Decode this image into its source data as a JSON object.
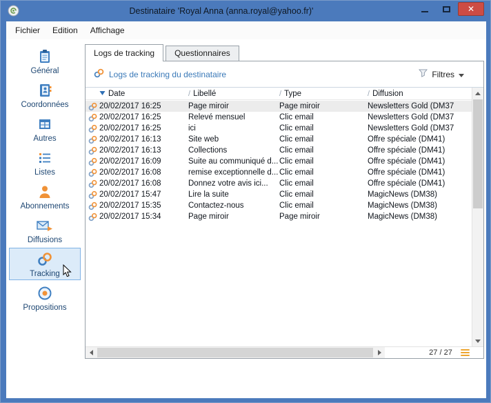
{
  "window": {
    "title": "Destinataire 'Royal Anna (anna.royal@yahoo.fr)'",
    "close_glyph": "✕"
  },
  "colors": {
    "frame_blue": "#4b7abc",
    "close_red": "#cd4c44",
    "link_blue": "#3a79b8",
    "accent_orange": "#f09237",
    "selection_blue": "#dcebf9"
  },
  "menu": {
    "items": [
      "Fichier",
      "Edition",
      "Affichage"
    ]
  },
  "sidebar": {
    "items": [
      {
        "label": "Général",
        "icon": "clipboard-icon"
      },
      {
        "label": "Coordonnées",
        "icon": "address-book-icon"
      },
      {
        "label": "Autres",
        "icon": "grid-icon"
      },
      {
        "label": "Listes",
        "icon": "list-icon"
      },
      {
        "label": "Abonnements",
        "icon": "person-icon"
      },
      {
        "label": "Diffusions",
        "icon": "mail-icon"
      },
      {
        "label": "Tracking",
        "icon": "link-icon",
        "selected": true
      },
      {
        "label": "Propositions",
        "icon": "target-icon"
      }
    ]
  },
  "tabs": [
    {
      "label": "Logs de tracking",
      "active": true
    },
    {
      "label": "Questionnaires",
      "active": false
    }
  ],
  "toolbar": {
    "heading": "Logs de tracking du destinataire",
    "filter_label": "Filtres"
  },
  "table": {
    "columns": [
      {
        "label": "Date",
        "sort_icon": "sort-desc-icon"
      },
      {
        "label": "Libellé",
        "sort_icon": "slash-icon"
      },
      {
        "label": "Type",
        "sort_icon": "slash-icon"
      },
      {
        "label": "Diffusion",
        "sort_icon": "slash-icon"
      }
    ],
    "rows": [
      {
        "date": "20/02/2017 16:25",
        "libelle": "Page miroir",
        "type": "Page miroir",
        "diffusion": "Newsletters Gold (DM37",
        "selected": true
      },
      {
        "date": "20/02/2017 16:25",
        "libelle": "Relevé mensuel",
        "type": "Clic email",
        "diffusion": "Newsletters Gold (DM37"
      },
      {
        "date": "20/02/2017 16:25",
        "libelle": "ici",
        "type": "Clic email",
        "diffusion": "Newsletters Gold (DM37"
      },
      {
        "date": "20/02/2017 16:13",
        "libelle": "Site web",
        "type": "Clic email",
        "diffusion": "Offre spéciale (DM41)"
      },
      {
        "date": "20/02/2017 16:13",
        "libelle": "Collections",
        "type": "Clic email",
        "diffusion": "Offre spéciale (DM41)"
      },
      {
        "date": "20/02/2017 16:09",
        "libelle": " Suite au communiqué d...",
        "type": "Clic email",
        "diffusion": "Offre spéciale (DM41)"
      },
      {
        "date": "20/02/2017 16:08",
        "libelle": "remise exceptionnelle d...",
        "type": "Clic email",
        "diffusion": "Offre spéciale (DM41)"
      },
      {
        "date": "20/02/2017 16:08",
        "libelle": "Donnez votre avis ici...",
        "type": "Clic email",
        "diffusion": "Offre spéciale (DM41)"
      },
      {
        "date": "20/02/2017 15:47",
        "libelle": "Lire la suite",
        "type": "Clic email",
        "diffusion": "MagicNews (DM38)"
      },
      {
        "date": "20/02/2017 15:35",
        "libelle": "Contactez-nous",
        "type": "Clic email",
        "diffusion": "MagicNews (DM38)"
      },
      {
        "date": "20/02/2017 15:34",
        "libelle": "Page miroir",
        "type": "Page miroir",
        "diffusion": "MagicNews (DM38)"
      }
    ]
  },
  "statusbar": {
    "counter": "27 / 27"
  }
}
